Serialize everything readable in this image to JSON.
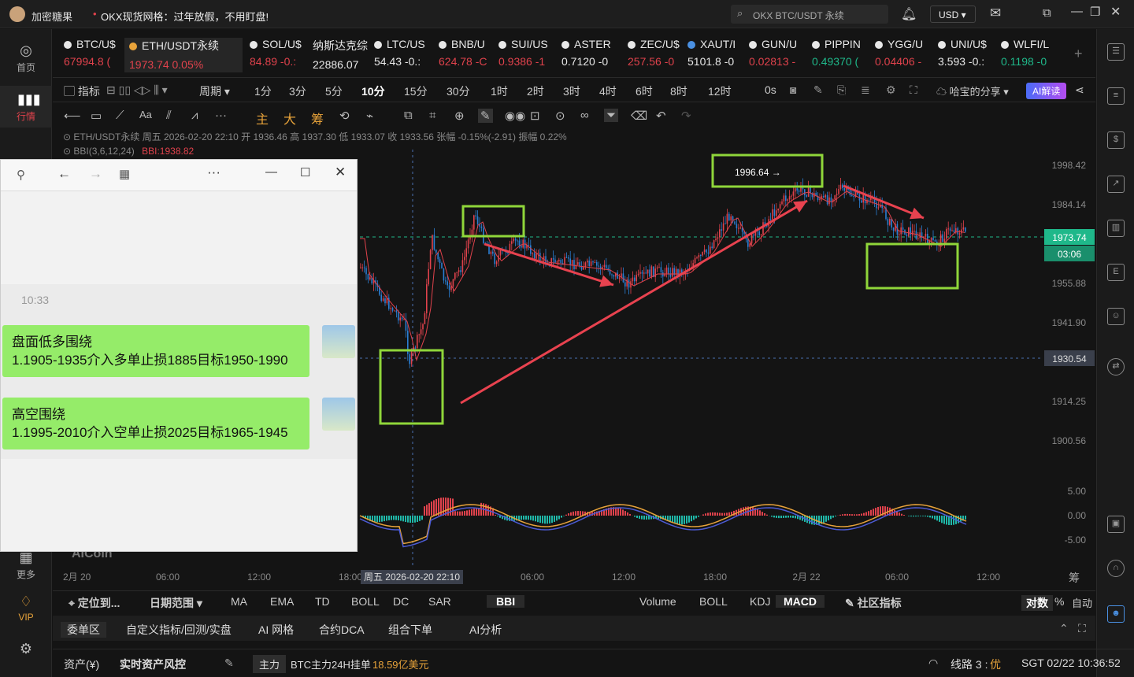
{
  "app": {
    "name": "加密糖果",
    "notice": "OKX现货网格：过年放假，不用盯盘!",
    "search_placeholder": "OKX BTC/USDT 永续",
    "currency": "USD"
  },
  "leftnav": [
    {
      "label": "首页",
      "icon": "home-icon"
    },
    {
      "label": "行情",
      "icon": "market-icon"
    },
    {
      "label": "更多",
      "icon": "more-icon"
    },
    {
      "label": "VIP",
      "icon": "vip-icon"
    }
  ],
  "tickers": [
    {
      "name": "BTC/U$",
      "price": "67994.8 (",
      "color": "#e0424c"
    },
    {
      "name": "ETH/USDT永续",
      "price": "1973.74  0.05%",
      "color": "#e0424c"
    },
    {
      "name": "SOL/U$",
      "price": "84.89  -0.:",
      "color": "#e0424c"
    },
    {
      "name": "纳斯达克综:",
      "price": "22886.07",
      "color": "#e8e8e8"
    },
    {
      "name": "LTC/US",
      "price": "54.43  -0.:",
      "color": "#e8e8e8"
    },
    {
      "name": "BNB/U",
      "price": "624.78  -C",
      "color": "#e0424c"
    },
    {
      "name": "SUI/US",
      "price": "0.9386  -1",
      "color": "#e0424c"
    },
    {
      "name": "ASTER",
      "price": "0.7120  -0",
      "color": "#e8e8e8"
    },
    {
      "name": "ZEC/U$",
      "price": "257.56  -0",
      "color": "#e0424c"
    },
    {
      "name": "XAUT/I",
      "price": "5101.8  -0",
      "color": "#e8e8e8"
    },
    {
      "name": "GUN/U",
      "price": "0.02813  -",
      "color": "#e0424c"
    },
    {
      "name": "PIPPIN",
      "price": "0.49370  (",
      "color": "#1fb88a"
    },
    {
      "name": "YGG/U",
      "price": "0.04406  -",
      "color": "#e0424c"
    },
    {
      "name": "UNI/U$",
      "price": "3.593  -0.:",
      "color": "#e8e8e8"
    },
    {
      "name": "WLFI/L",
      "price": "0.1198  -0",
      "color": "#1fb88a"
    }
  ],
  "toolbar": {
    "indicators": "指标",
    "period": "周期",
    "intervals": [
      "1分",
      "3分",
      "5分",
      "10分",
      "15分",
      "30分",
      "1时",
      "2时",
      "3时",
      "4时",
      "6时",
      "8时",
      "12时",
      "0s"
    ],
    "active_interval": "10分",
    "share": "哈宝的分享",
    "ai": "AI解读"
  },
  "drawtools": {
    "main": "主",
    "big": "大",
    "chip": "筹"
  },
  "info": {
    "line1": "ETH/USDT永续  周五 2026-02-20 22:10  开 1936.46  高 1937.30  低 1933.07  收 1933.56  张幅 -0.15%(-2.91)  振幅 0.22%",
    "line2_label": "BBI(3,6,12,24)",
    "line2_value": "BBI:1938.82"
  },
  "price_axis": [
    "1998.42",
    "1984.14",
    "1955.88",
    "1941.90",
    "1914.25",
    "1900.56"
  ],
  "current_price": "1973.74",
  "countdown": "03:06",
  "cross_price": "1930.54",
  "macd_axis": [
    "5.00",
    "0.00",
    "-5.00"
  ],
  "time_axis": [
    "2月 20",
    "06:00",
    "12:00",
    "18:00",
    "06:00",
    "12:00",
    "18:00",
    "2月 22",
    "06:00",
    "12:00"
  ],
  "cursor_time": "周五 2026-02-20 22:10",
  "annotation_high": "1996.64 →",
  "watermark": "AICoin",
  "popup": {
    "time": "10:33",
    "msg1_title": "盘面低多围绕",
    "msg1_body": "1.1905-1935介入多单止损1885目标1950-1990",
    "msg2_title": "高空围绕",
    "msg2_body": "1.1995-2010介入空单止损2025目标1965-1945"
  },
  "bottom_indicators": {
    "locate": "定位到...",
    "range": "日期范围",
    "main": [
      "MA",
      "EMA",
      "TD",
      "BOLL",
      "DC",
      "SAR",
      "BBI"
    ],
    "active_main": "BBI",
    "sub": [
      "Volume",
      "BOLL",
      "KDJ",
      "MACD"
    ],
    "active_sub": "MACD",
    "community": "社区指标",
    "log": "对数",
    "pct": "%",
    "auto": "自动"
  },
  "bottom_tabs": [
    "委单区",
    "自定义指标/回测/实盘",
    "AI 网格",
    "合约DCA",
    "组合下单",
    "AI分析"
  ],
  "status": {
    "assets": "资产(¥)",
    "risk": "实时资产风控",
    "main_force": "主力",
    "btc_label": "BTC主力24H挂单",
    "btc_value": "18.59亿美元",
    "line": "线路 3 :",
    "line_quality": "优",
    "time": "SGT  02/22 10:36:52"
  }
}
